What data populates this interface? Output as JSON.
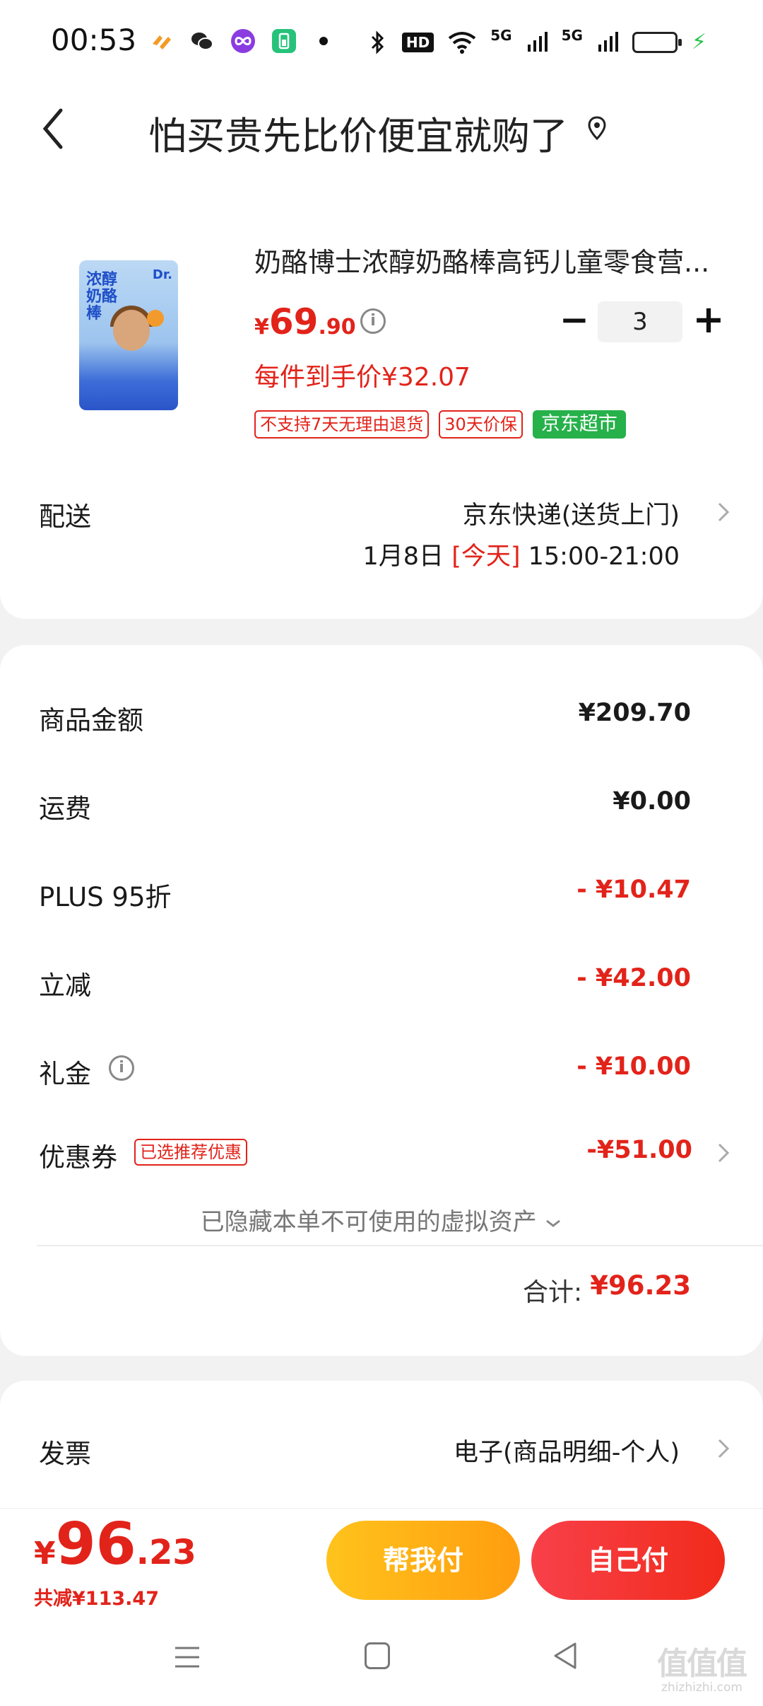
{
  "status_bar": {
    "time": "00:53",
    "network_1": "5G",
    "network_2": "5G",
    "hd_label": "HD"
  },
  "header": {
    "title": "怕买贵先比价便宜就购了"
  },
  "product": {
    "name": "奶酪博士浓醇奶酪棒高钙儿童零食营...",
    "price_currency": "¥",
    "price_integer": "69",
    "price_decimal": ".90",
    "quantity": "3",
    "unit_price_text": "每件到手价¥32.07",
    "tags": [
      "不支持7天无理由退货",
      "30天价保",
      "京东超市"
    ],
    "image_text": "浓醇奶酪棒",
    "image_logo": "Dr."
  },
  "delivery": {
    "label": "配送",
    "method": "京东快递(送货上门)",
    "date": "1月8日",
    "today": "[今天]",
    "time_window": "15:00-21:00"
  },
  "summary": {
    "goods_amount_label": "商品金额",
    "goods_amount": "¥209.70",
    "shipping_label": "运费",
    "shipping": "¥0.00",
    "plus_label": "PLUS 95折",
    "plus_discount": "- ¥10.47",
    "instant_label": "立减",
    "instant_discount": "- ¥42.00",
    "gift_label": "礼金",
    "gift_discount": "- ¥10.00",
    "coupon_label": "优惠券",
    "coupon_tag": "已选推荐优惠",
    "coupon_discount": "-¥51.00",
    "hidden_assets": "已隐藏本单不可使用的虚拟资产",
    "total_label": "合计:",
    "total": "¥96.23"
  },
  "invoice": {
    "label": "发票",
    "value": "电子(商品明细-个人)"
  },
  "bottom_bar": {
    "pay_currency": "¥",
    "pay_integer": "96",
    "pay_decimal": ".23",
    "saved_text": "共减¥113.47",
    "help_pay_label": "帮我付",
    "self_pay_label": "自己付"
  },
  "watermark": {
    "main": "值值值",
    "sub": "zhizhizhi.com"
  },
  "colors": {
    "accent_red": "#e2231a",
    "help_button": "#ffb418",
    "self_button": "#f3332a",
    "jd_supermarket_green": "#26b14a"
  }
}
